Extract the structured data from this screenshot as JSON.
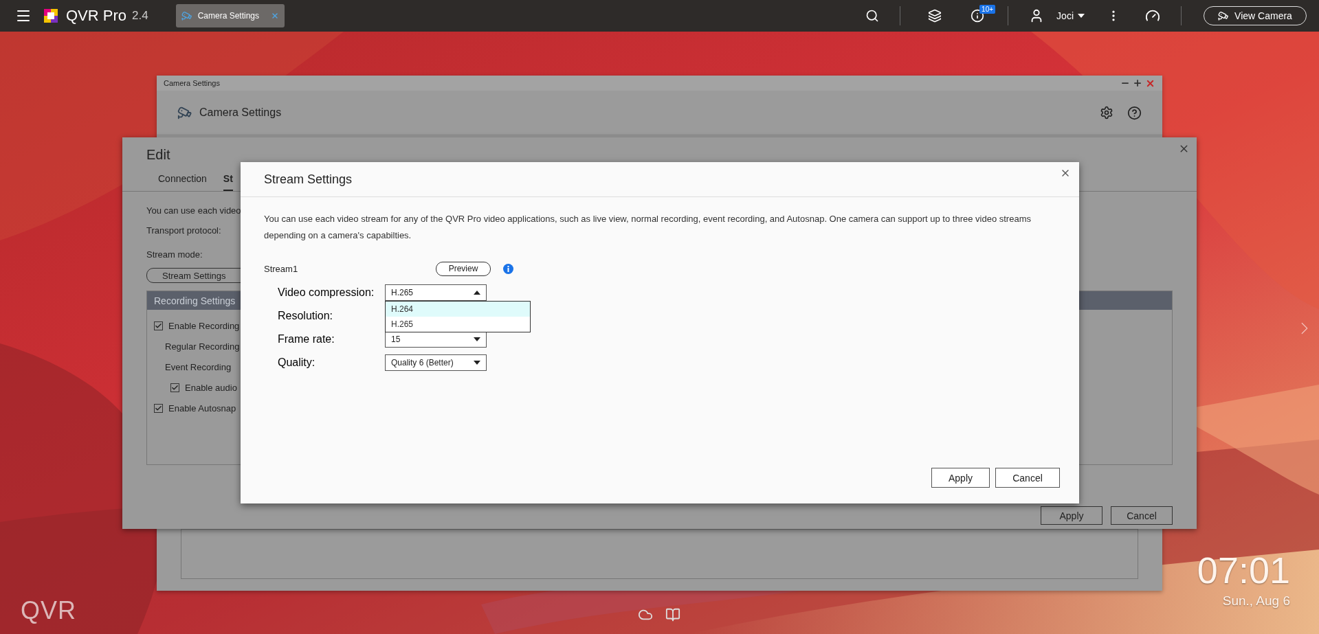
{
  "top_bar": {
    "app_name": "QVR Pro",
    "version": "2.4",
    "tabs": [
      {
        "label": "Camera Settings",
        "selected": true
      }
    ],
    "notification_badge": "10+",
    "user": "Joci",
    "view_camera": "View Camera"
  },
  "camera_settings_window": {
    "title": "Camera Settings",
    "header": "Camera Settings"
  },
  "edit_dialog": {
    "title": "Edit",
    "tabs": [
      {
        "label": "Connection",
        "selected": false
      },
      {
        "label": "St",
        "selected": true
      }
    ],
    "intro": "You can use each video",
    "labels": [
      "Transport protocol:",
      "Stream mode:"
    ],
    "stream_settings_button": "Stream Settings",
    "recording_panel": {
      "title": "Recording Settings",
      "items": [
        {
          "kind": "checkbox",
          "label": "Enable Recording",
          "checked": true,
          "children": [
            {
              "kind": "text",
              "label": "Regular Recording"
            },
            {
              "kind": "text",
              "label": "Event Recording"
            },
            {
              "kind": "checkbox",
              "label": "Enable audio",
              "checked": true
            }
          ]
        },
        {
          "kind": "checkbox",
          "label": "Enable Autosnap",
          "checked": true
        }
      ]
    },
    "buttons": [
      "Apply",
      "Cancel"
    ]
  },
  "stream_dialog": {
    "title": "Stream Settings",
    "description": "You can use each video stream for any of the QVR Pro video applications, such as live view, normal recording, event recording, and Autosnap. One camera can support up to three video streams depending on a camera's capabilties.",
    "stream_name": "Stream1",
    "preview_button": "Preview",
    "fields": [
      {
        "label": "Video compression:",
        "value": "H.265",
        "open": true,
        "options": [
          {
            "label": "H.264",
            "highlighted": true
          },
          {
            "label": "H.265",
            "highlighted": false
          }
        ]
      },
      {
        "label": "Resolution:"
      },
      {
        "label": "Frame rate:",
        "value": "15",
        "open": false
      },
      {
        "label": "Quality:",
        "value": "Quality 6 (Better)",
        "open": false
      }
    ],
    "buttons": [
      "Apply",
      "Cancel"
    ]
  },
  "clock": {
    "time": "07:01",
    "date": "Sun., Aug 6"
  },
  "desktop_logo": "QVR"
}
